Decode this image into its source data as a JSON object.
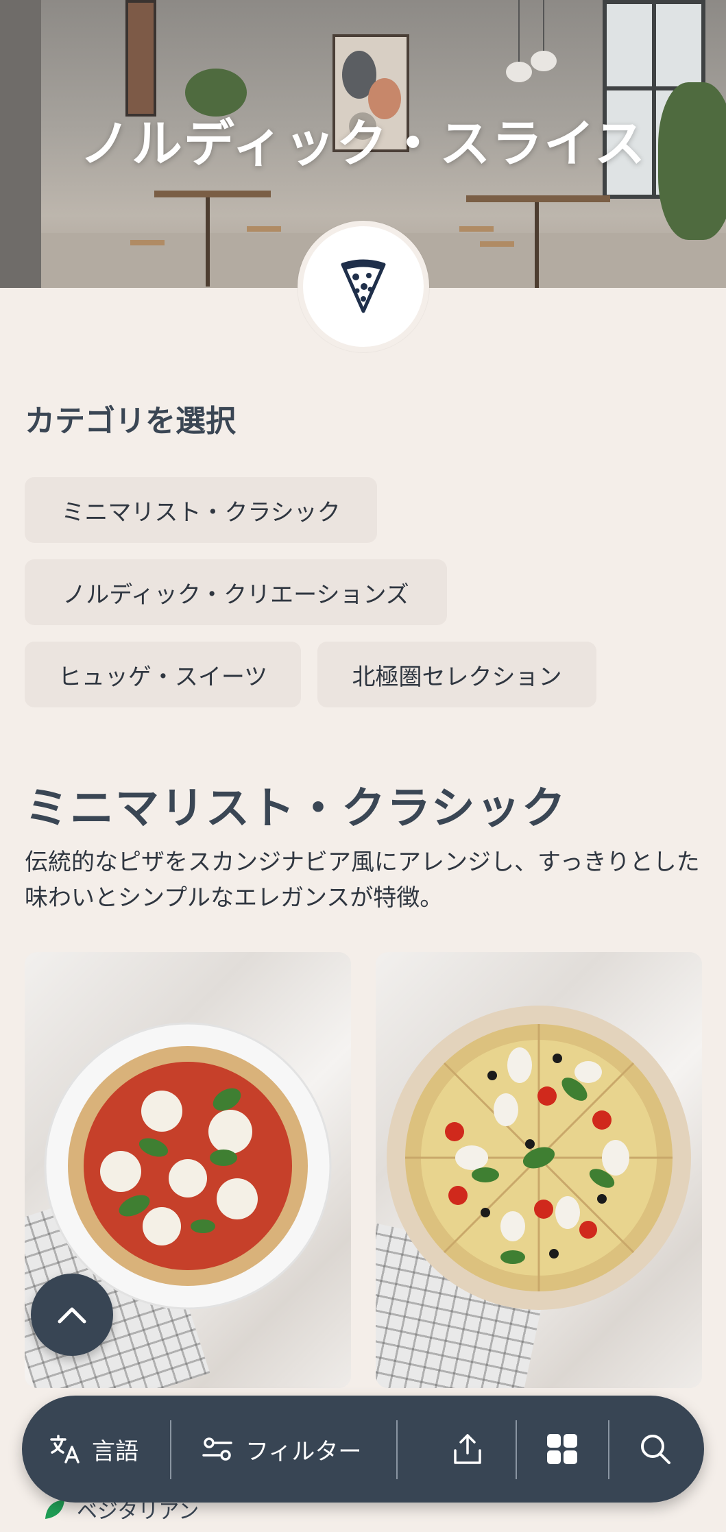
{
  "hero": {
    "title": "ノルディック・スライス"
  },
  "categories": {
    "heading": "カテゴリを選択",
    "chips": [
      {
        "label": "ミニマリスト・クラシック"
      },
      {
        "label": "ノルディック・クリエーションズ"
      },
      {
        "label": "ヒュッゲ・スイーツ"
      },
      {
        "label": "北極圏セレクション"
      }
    ]
  },
  "section": {
    "title": "ミニマリスト・クラシック",
    "description": "伝統的なピザをスカンジナビア風にアレンジし、すっきりとした味わいとシンプルなエレガンスが特徴。"
  },
  "bottom_bar": {
    "language_label": "言語",
    "filter_label": "フィルター"
  },
  "below_bar": {
    "label": "ベジタリアン"
  },
  "icons": {
    "logo": "pizza-slice-icon",
    "scroll_top": "chevron-up-icon",
    "language": "translate-icon",
    "filter": "sliders-icon",
    "share": "share-icon",
    "grid": "grid-icon",
    "search": "search-icon",
    "vegetarian": "leaf-icon"
  },
  "colors": {
    "background": "#f4eee9",
    "accent_dark": "#384554",
    "chip_bg": "#ebe4df",
    "text": "#3a4654",
    "vegetarian_green": "#1f9d55"
  }
}
